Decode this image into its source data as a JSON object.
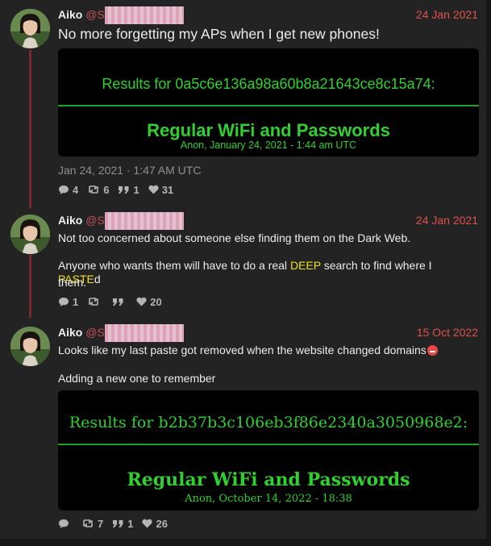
{
  "posts": [
    {
      "author": "Aiko",
      "handle": "@Sa",
      "date": "24 Jan 2021",
      "text": "No more forgetting my APs when I get new phones!",
      "card": {
        "results": "Results for 0a5c6e136a98a60b8a21643ce8c15a74:",
        "title": "Regular WiFi and Passwords",
        "subtitle": "Anon, January 24, 2021 - 1:44 am UTC"
      },
      "timestamp": "Jan 24, 2021 · 1:47 AM UTC",
      "stats": {
        "replies": "4",
        "retweets": "6",
        "quotes": "1",
        "likes": "31"
      }
    },
    {
      "author": "Aiko",
      "handle": "@Sa",
      "date": "24 Jan 2021",
      "line1": "Not too concerned about someone else finding them on the Dark Web.",
      "line2a": "Anyone who wants them will have to do a real ",
      "line2_hl1": "DEEP",
      "line2b": " search to find where I ",
      "line2_hl2": "PASTE",
      "line2c": "d",
      "line3": "them.",
      "stats": {
        "replies": "1",
        "retweets": "",
        "quotes": "",
        "likes": "20"
      }
    },
    {
      "author": "Aiko",
      "handle": "@S",
      "date": "15 Oct 2022",
      "line1": "Looks like my last paste got removed when the website changed domains",
      "line2": "Adding a new one to remember",
      "card": {
        "results": "Results for b2b37b3c106eb3f86e2340a3050968e2:",
        "title": "Regular WiFi and Passwords",
        "subtitle": "Anon, October 14, 2022 - 18:38"
      },
      "stats": {
        "replies": "",
        "retweets": "7",
        "quotes": "1",
        "likes": "26"
      }
    }
  ],
  "colors": {
    "accent": "#e0524b",
    "terminal_green": "#2ed12e",
    "thread_line": "#7a2a2a"
  }
}
